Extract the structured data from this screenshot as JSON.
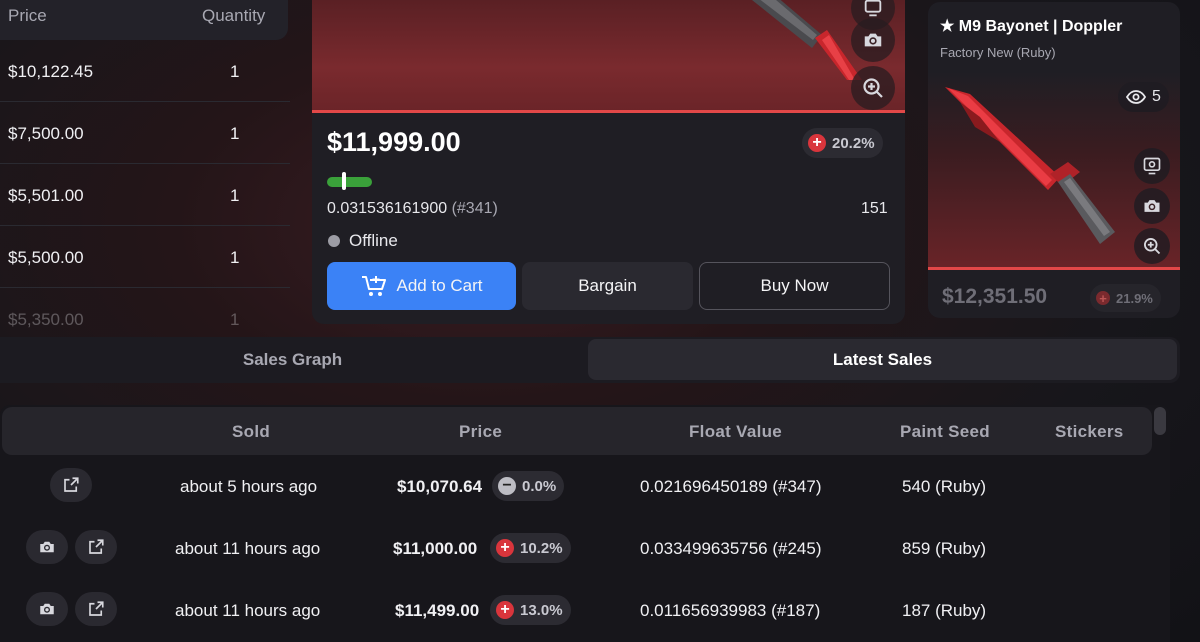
{
  "listings": {
    "headers": {
      "price": "Price",
      "quantity": "Quantity"
    },
    "rows": [
      {
        "price": "$10,122.45",
        "quantity": "1"
      },
      {
        "price": "$7,500.00",
        "quantity": "1"
      },
      {
        "price": "$5,501.00",
        "quantity": "1"
      },
      {
        "price": "$5,500.00",
        "quantity": "1"
      },
      {
        "price": "$5,350.00",
        "quantity": "1"
      }
    ]
  },
  "main_item": {
    "price": "$11,999.00",
    "change_pct": "20.2%",
    "float_value": "0.031536161900",
    "float_rank": "(#341)",
    "paint_seed": "151",
    "status": "Offline",
    "add_to_cart_label": "Add to Cart",
    "bargain_label": "Bargain",
    "buy_now_label": "Buy Now"
  },
  "side_item": {
    "title": "★ M9 Bayonet | Doppler",
    "condition": "Factory New (Ruby)",
    "views": "5",
    "price": "$12,351.50",
    "change_pct": "21.9%"
  },
  "tabs": {
    "sales_graph": "Sales Graph",
    "latest_sales": "Latest Sales"
  },
  "sales": {
    "headers": {
      "sold": "Sold",
      "price": "Price",
      "float": "Float Value",
      "seed": "Paint Seed",
      "stickers": "Stickers"
    },
    "rows": [
      {
        "sold": "about 5 hours ago",
        "price": "$10,070.64",
        "change": "0.0%",
        "float": "0.021696450189 (#347)",
        "seed": "540 (Ruby)"
      },
      {
        "sold": "about 11 hours ago",
        "price": "$11,000.00",
        "change": "10.2%",
        "float": "0.033499635756 (#245)",
        "seed": "859 (Ruby)"
      },
      {
        "sold": "about 11 hours ago",
        "price": "$11,499.00",
        "change": "13.0%",
        "float": "0.011656939983 (#187)",
        "seed": "187 (Ruby)"
      }
    ]
  },
  "colors": {
    "accent_blue": "#3b82f6",
    "ruby_red": "#e24848",
    "float_green": "#3aa13a"
  }
}
